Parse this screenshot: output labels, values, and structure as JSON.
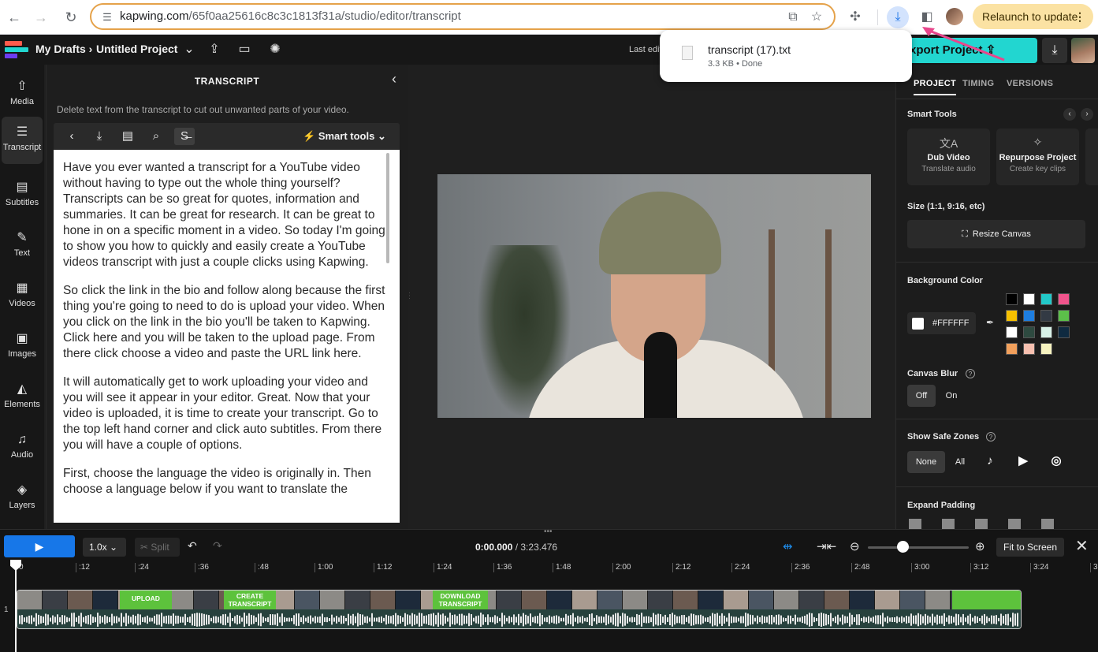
{
  "browser": {
    "url_domain": "kapwing.com",
    "url_path": "/65f0aa25616c8c3c1813f31a/studio/editor/transcript",
    "relaunch_label": "Relaunch to update"
  },
  "download_popup": {
    "file_name": "transcript (17).txt",
    "file_meta": "3.3 KB • Done"
  },
  "header": {
    "drafts_label": "My Drafts",
    "project_name": "Untitled Project",
    "last_edit": "Last edit",
    "export_label": "xport Project"
  },
  "rail": {
    "items": [
      {
        "label": "Media",
        "icon": "upload-icon"
      },
      {
        "label": "Transcript",
        "icon": "transcript-icon"
      },
      {
        "label": "Subtitles",
        "icon": "subtitles-icon"
      },
      {
        "label": "Text",
        "icon": "text-icon"
      },
      {
        "label": "Videos",
        "icon": "film-icon"
      },
      {
        "label": "Images",
        "icon": "image-icon"
      },
      {
        "label": "Elements",
        "icon": "shapes-icon"
      },
      {
        "label": "Audio",
        "icon": "music-icon"
      },
      {
        "label": "Layers",
        "icon": "layers-icon"
      }
    ]
  },
  "transcript": {
    "title": "TRANSCRIPT",
    "hint": "Delete text from the transcript to cut out unwanted parts of your video.",
    "smart_tools_label": "Smart tools",
    "paragraphs": [
      "Have you ever wanted a transcript for a YouTube video without having to type out the whole thing yourself? Transcripts can be so great for quotes, information and summaries. It can be great for research. It can be great to hone in on a specific moment in a video. So today I'm going to show you how to quickly and easily create a YouTube videos transcript with just a couple clicks using Kapwing.",
      "So click the link in the bio and follow along because the first thing you're going to need to do is upload your video. When you click on the link in the bio you'll be taken to Kapwing. Click here and you will be taken to the upload page. From there click choose a video and paste the URL link here.",
      "It will automatically get to work uploading your video and you will see it appear in your editor. Great. Now that your video is uploaded, it is time to create your transcript. Go to the top left hand corner and click auto subtitles. From there you will have a couple of options.",
      "First, choose the language the video is originally in. Then choose a language below if you want to translate the"
    ]
  },
  "props": {
    "tabs": [
      "PROJECT",
      "TIMING",
      "VERSIONS"
    ],
    "smart_tools_heading": "Smart Tools",
    "cards": [
      {
        "title": "Dub Video",
        "subtitle": "Translate audio",
        "icon": "translate-icon"
      },
      {
        "title": "Repurpose Project",
        "subtitle": "Create key clips",
        "icon": "sparkle-icon"
      }
    ],
    "size_heading": "Size (1:1, 9:16, etc)",
    "resize_label": "Resize Canvas",
    "bg_heading": "Background Color",
    "bg_hex": "#FFFFFF",
    "swatches": [
      "#000000",
      "#ffffff",
      "#22c8c8",
      "#f0548c",
      "#f6c000",
      "#1e7ee0",
      "#333a44",
      "#5cbf4a",
      "#ffffff",
      "#2e4a40",
      "#d8f1e8",
      "#0f2a40",
      "#f2a05c",
      "#f7c0b0",
      "#f7f3c0"
    ],
    "blur_heading": "Canvas Blur",
    "blur_off": "Off",
    "blur_on": "On",
    "safe_heading": "Show Safe Zones",
    "safe_none": "None",
    "safe_all": "All",
    "padding_heading": "Expand Padding"
  },
  "timeline": {
    "speed": "1.0x",
    "split_label": "Split",
    "current_time": "0:00.000",
    "total_time": "/ 3:23.476",
    "fit_label": "Fit to Screen",
    "track_number": "1",
    "ruler": [
      "0",
      ":12",
      ":24",
      ":36",
      ":48",
      "1:00",
      "1:12",
      "1:24",
      "1:36",
      "1:48",
      "2:00",
      "2:12",
      "2:24",
      "2:36",
      "2:48",
      "3:00",
      "3:12",
      "3:24",
      "3:3"
    ],
    "clip_labels": [
      "UPLOAD",
      "CREATE TRANSCRIPT",
      "DOWNLOAD TRANSCRIPT"
    ]
  }
}
